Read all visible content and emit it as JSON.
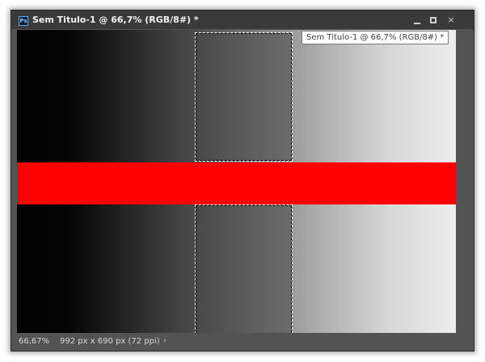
{
  "window": {
    "title": "Sem Titulo-1 @ 66,7% (RGB/8#) *",
    "app_icon": "Ps",
    "tooltip": "Sem Titulo-1 @ 66,7% (RGB/8#) *"
  },
  "window_controls": {
    "minimize": "minimize-icon",
    "maximize": "maximize-icon",
    "close": "×"
  },
  "canvas": {
    "stripe_color": "#ff0000",
    "gradient_start": "#000000",
    "gradient_end": "#ededed"
  },
  "status": {
    "zoom": "66,67%",
    "doc_info": "992 px x 690 px (72 ppi)",
    "arrow": "›"
  }
}
